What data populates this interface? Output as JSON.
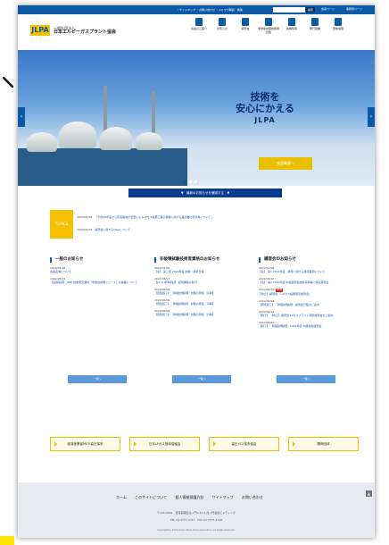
{
  "utility": {
    "links": "・サイトマップ ・お問い合わせ ・メルマガ購読・解除",
    "search_button": "検索",
    "mypage": "会員ページ",
    "member": "事務局ページ"
  },
  "logo": {
    "mark": "JLPA",
    "line1": "一般社団法人",
    "line2": "日本エルピーガスプラント協会"
  },
  "gnav": [
    {
      "label": "協会のご紹介",
      "icon": "building-icon"
    },
    {
      "label": "お知らせ",
      "icon": "notice-icon"
    },
    {
      "label": "講習会",
      "icon": "lecture-icon"
    },
    {
      "label": "非破壊試験技術者資格",
      "icon": "certificate-icon"
    },
    {
      "label": "各種情報",
      "icon": "document-icon"
    },
    {
      "label": "発行図書",
      "icon": "book-icon"
    },
    {
      "label": "団体保険",
      "icon": "insurance-icon"
    }
  ],
  "hero": {
    "copy_line1": "技術を",
    "copy_line2": "安心にかえる",
    "copy_en": "JLPA",
    "cta": "協会概要へ",
    "prev": "‹",
    "next": "›"
  },
  "notice_bar": "▼　最新のお知らせを確認する　▼",
  "topics": {
    "tag": "TOPICS",
    "rows": [
      {
        "date": "2023/02/26",
        "text": "「平成30年度から年度開始が変更によるLPガス設備工事の承継に関する届出書の様式等について」"
      },
      {
        "date": "2023/02/15",
        "text": "講習会に関するQ&Aについて"
      }
    ]
  },
  "columns": [
    {
      "heading": "一般のお知らせ",
      "entries": [
        {
          "date": "2016/04/18",
          "title": "会員名簿について"
        },
        {
          "date": "2022/05/19",
          "title": "【会員情報】 JPMI 技術研究課題「非破壊試験シリーズ」の掲載について"
        }
      ],
      "more": "一覧へ"
    },
    {
      "heading": "非破壊試験技術者資格のお知らせ",
      "entries": [
        {
          "date": "2022/05/05",
          "title": "【注】 第二回 2022年度 試験・講習日程"
        },
        {
          "date": "2021/05/17",
          "title": "【JIS Q 標準認証】 証明書等の移行"
        },
        {
          "date": "2022/06/06",
          "title": "【募集終了】 【特級試験者】 試験の募集 【1期】"
        },
        {
          "date": "2022/06/06",
          "title": "【募集終了】 【特級試験者】 試験の募集 【2期】"
        },
        {
          "date": "2022/06/06",
          "title": "【募集終了】 【特級試験者】 試験の募集 【3期】"
        }
      ],
      "more": "一覧へ"
    },
    {
      "heading": "講習会のお知らせ",
      "entries": [
        {
          "date": "2022/01/08",
          "title": "【注】 第1 2022年度　講習に関する確認事項について"
        },
        {
          "date": "2022/05/10",
          "title": "【注】 第2 2022年度 中級講習会技術基準等に係る講習会"
        },
        {
          "date": "2022/06/10",
          "title": "【中止】講習会　「LPガス設備保安講習会」",
          "new": "NEW"
        },
        {
          "date": "2022/06/06",
          "title": "【募集終了】 【特級試験者】 講習会日程のご案内"
        },
        {
          "date": "2022/06/10",
          "title": "【終了】 【中止】講習会 LPガスプラント保安講習会のご案内"
        },
        {
          "date": "2022/06/20",
          "title": "【終了】 【特級試験者】 2022年度 中級技術講習会"
        }
      ],
      "more": "一覧へ"
    }
  ],
  "banners": [
    {
      "label": "経済産業省METI高圧保安"
    },
    {
      "label": "日本LPガス団体協議会"
    },
    {
      "label": "高圧ガス保安協会"
    },
    {
      "label": "関係団体"
    }
  ],
  "footer": {
    "links": [
      "ホーム",
      "このサイトについて",
      "個人情報保護方針",
      "サイトマップ",
      "お問い合わせ"
    ],
    "addr1": "〒105-0001　東京都港区虎ノ門1-25-6 虎ノ門会館ビルディング",
    "addr2": "TEL 03-3777-4747　FAX 03-3777-4748",
    "copyright": "Copyright(C) 2022 Japan LPGas Plant Association. All Rights Reserved."
  }
}
